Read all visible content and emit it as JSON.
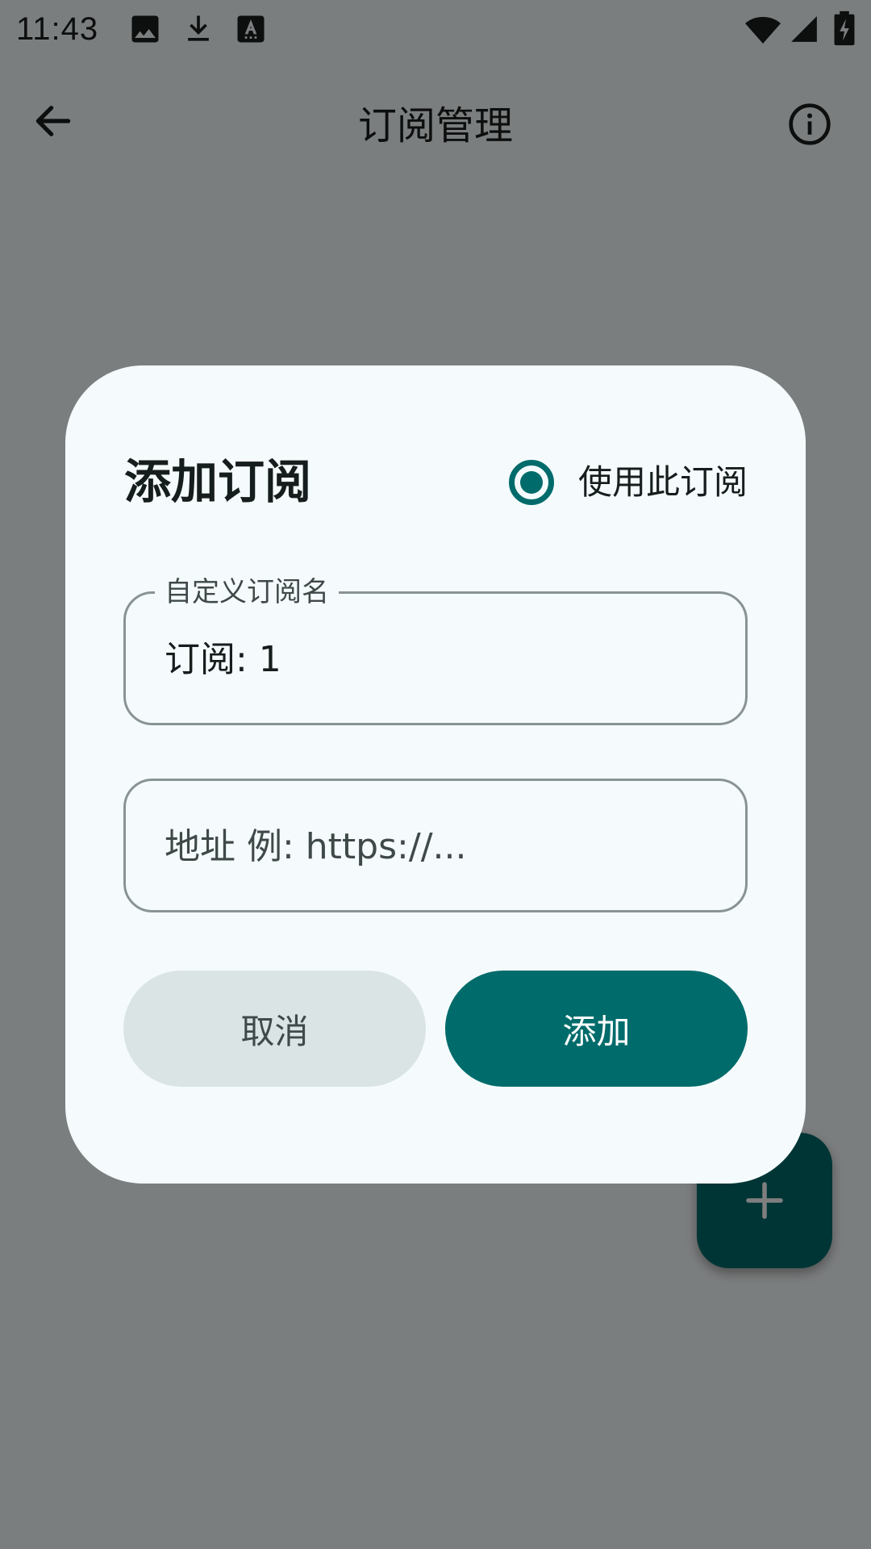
{
  "status_bar": {
    "time": "11:43",
    "icons": [
      "image-icon",
      "download-icon",
      "keyboard-a-icon",
      "wifi-icon",
      "signal-icon",
      "battery-charging-icon"
    ]
  },
  "topbar": {
    "title": "订阅管理",
    "back_icon": "arrow-left-icon",
    "info_icon": "info-icon"
  },
  "fab": {
    "icon": "plus-icon"
  },
  "dialog": {
    "title": "添加订阅",
    "use_subscription": {
      "label": "使用此订阅",
      "selected": true
    },
    "name_field": {
      "label": "自定义订阅名",
      "value": "订阅: 1"
    },
    "url_field": {
      "placeholder": "地址 例: https://..."
    },
    "cancel_label": "取消",
    "add_label": "添加"
  },
  "colors": {
    "accent": "#006b6b",
    "dialog_bg": "#f5fbfc",
    "cancel_bg": "#dae4e5",
    "outline": "#8a9393"
  }
}
